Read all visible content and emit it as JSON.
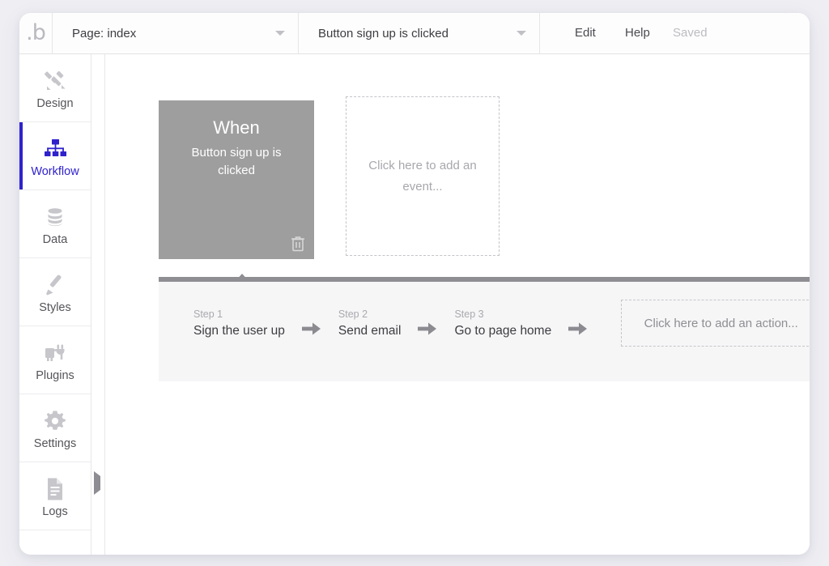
{
  "topbar": {
    "logo": "bubble-logo-icon",
    "page_dropdown": {
      "value": "Page: index",
      "caret": "chevron-down-icon"
    },
    "event_dropdown": {
      "value": "Button sign up is clicked",
      "caret": "chevron-down-icon"
    },
    "edit_label": "Edit",
    "help_label": "Help",
    "saved_label": "Saved"
  },
  "sidebar": {
    "items": [
      {
        "label": "Design",
        "icon": "design-tools-icon",
        "active": false
      },
      {
        "label": "Workflow",
        "icon": "workflow-nodes-icon",
        "active": true
      },
      {
        "label": "Data",
        "icon": "database-icon",
        "active": false
      },
      {
        "label": "Styles",
        "icon": "paintbrush-icon",
        "active": false
      },
      {
        "label": "Plugins",
        "icon": "plug-icon",
        "active": false
      },
      {
        "label": "Settings",
        "icon": "gear-icon",
        "active": false
      },
      {
        "label": "Logs",
        "icon": "document-lines-icon",
        "active": false
      }
    ],
    "collapse_icon": "triangle-right-icon",
    "active_color": "#2f22cc"
  },
  "canvas": {
    "event_card": {
      "title": "When",
      "subtitle": "Button sign up is clicked",
      "background_color": "#9e9e9e",
      "delete_icon": "trash-icon"
    },
    "add_event_placeholder": "Click here to add an event...",
    "steps_panel": {
      "bar_color": "#8e8e93",
      "steps": [
        {
          "number": "Step 1",
          "title": "Sign the user up"
        },
        {
          "number": "Step 2",
          "title": "Send email"
        },
        {
          "number": "Step 3",
          "title": "Go to page home"
        }
      ],
      "arrow_icon": "arrow-right-icon",
      "add_action_placeholder": "Click here to add an action..."
    }
  }
}
